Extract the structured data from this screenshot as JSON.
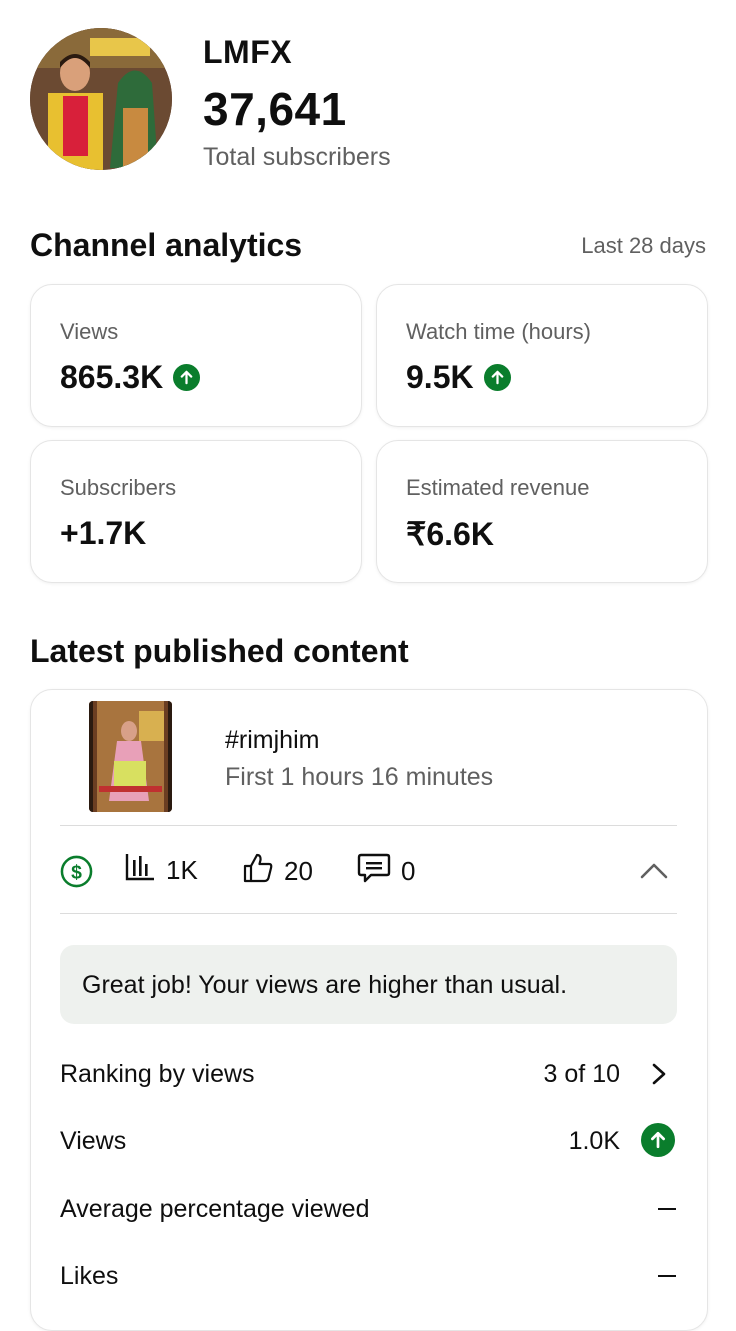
{
  "channel": {
    "name": "LMFX",
    "subscribers": "37,641",
    "subscribers_label": "Total subscribers"
  },
  "analytics": {
    "title": "Channel analytics",
    "period": "Last 28 days",
    "cards": [
      {
        "label": "Views",
        "value": "865.3K",
        "trend": "up"
      },
      {
        "label": "Watch time (hours)",
        "value": "9.5K",
        "trend": "up"
      },
      {
        "label": "Subscribers",
        "value": "+1.7K",
        "trend": "none"
      },
      {
        "label": "Estimated revenue",
        "value": "₹6.6K",
        "trend": "none"
      }
    ]
  },
  "latest": {
    "title": "Latest published content",
    "video": {
      "title": "#rimjhim",
      "meta": "First 1 hours 16 minutes"
    },
    "stats": {
      "views": "1K",
      "likes": "20",
      "comments": "0"
    },
    "notice": "Great job! Your views are higher than usual.",
    "rows": [
      {
        "label": "Ranking by views",
        "value": "3 of 10"
      },
      {
        "label": "Views",
        "value": "1.0K"
      },
      {
        "label": "Average percentage viewed",
        "value": ""
      },
      {
        "label": "Likes",
        "value": ""
      }
    ]
  },
  "colors": {
    "accent_green": "#0a7d2c",
    "secondary_text": "#606060"
  },
  "icons": [
    "up-arrow-icon",
    "dollar-icon",
    "bar-chart-icon",
    "thumbs-up-icon",
    "comment-icon",
    "chevron-up-icon",
    "chevron-right-icon"
  ]
}
